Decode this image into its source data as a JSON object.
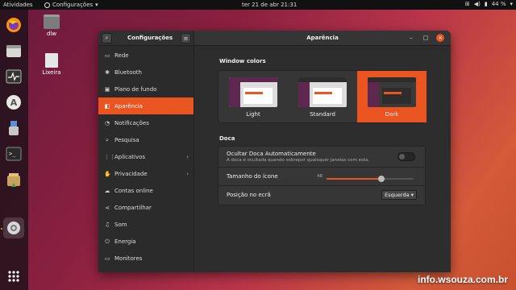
{
  "topbar": {
    "activities": "Atividades",
    "app_menu": "Configurações",
    "clock": "ter 21 de abr  21:31",
    "battery": "44 %"
  },
  "dock": {
    "items": [
      {
        "name": "firefox-icon"
      },
      {
        "name": "files-icon"
      },
      {
        "name": "system-monitor-icon"
      },
      {
        "name": "software-center-icon"
      },
      {
        "name": "usb-creator-icon"
      },
      {
        "name": "terminal-icon"
      },
      {
        "name": "archive-manager-icon"
      },
      {
        "name": "settings-icon"
      },
      {
        "name": "show-apps-icon"
      }
    ]
  },
  "desktop": {
    "home_label": "dlw",
    "trash_label": "Lixeira"
  },
  "window": {
    "sidebar_title": "Configurações",
    "main_title": "Aparência",
    "sidebar_items": [
      {
        "label": "Rede",
        "icon": "network-icon",
        "glyph": "▭",
        "arrow": false
      },
      {
        "label": "Bluetooth",
        "icon": "bluetooth-icon",
        "glyph": "✱",
        "arrow": false
      },
      {
        "label": "Plano de fundo",
        "icon": "background-icon",
        "glyph": "▣",
        "arrow": false
      },
      {
        "label": "Aparência",
        "icon": "appearance-icon",
        "glyph": "◧",
        "arrow": false,
        "selected": true
      },
      {
        "label": "Notificações",
        "icon": "bell-icon",
        "glyph": "◔",
        "arrow": false
      },
      {
        "label": "Pesquisa",
        "icon": "search-icon",
        "glyph": "⌕",
        "arrow": false
      },
      {
        "label": "Aplicativos",
        "icon": "apps-icon",
        "glyph": "⋮⋮",
        "arrow": true
      },
      {
        "label": "Privacidade",
        "icon": "privacy-icon",
        "glyph": "✋",
        "arrow": true
      },
      {
        "label": "Contas online",
        "icon": "cloud-icon",
        "glyph": "☁",
        "arrow": false
      },
      {
        "label": "Compartilhar",
        "icon": "share-icon",
        "glyph": "⋖",
        "arrow": false
      },
      {
        "label": "Som",
        "icon": "music-icon",
        "glyph": "♫",
        "arrow": false
      },
      {
        "label": "Energia",
        "icon": "power-icon",
        "glyph": "⏻",
        "arrow": false
      },
      {
        "label": "Monitores",
        "icon": "display-icon",
        "glyph": "▭",
        "arrow": false
      }
    ],
    "window_colors_title": "Window colors",
    "themes": [
      {
        "label": "Light"
      },
      {
        "label": "Standard"
      },
      {
        "label": "Dark",
        "selected": true
      }
    ],
    "dock_title": "Doca",
    "autohide": {
      "title": "Ocultar Doca Automaticamente",
      "subtitle": "A doca é ocultada quando sobrepor quaisquer janelas com esta.",
      "enabled": false
    },
    "icon_size": {
      "label": "Tamanho do ícone",
      "value": "48",
      "fraction": 0.63
    },
    "position": {
      "label": "Posição no ecrã",
      "value": "Esquerda"
    }
  },
  "watermark": "info.wsouza.com.br"
}
